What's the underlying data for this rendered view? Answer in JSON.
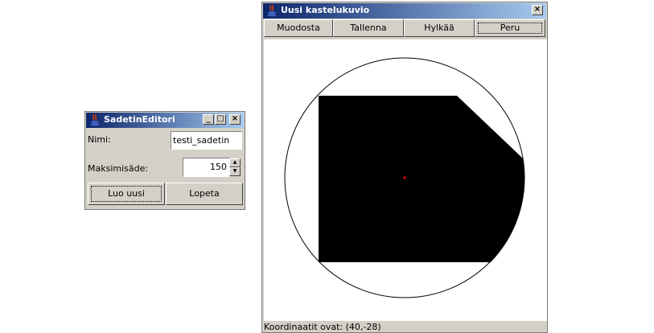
{
  "editor": {
    "title": "SadetinEditori",
    "title_buttons": {
      "minimize": "_",
      "maximize": "□",
      "close": "×"
    },
    "name_label": "Nimi:",
    "name_value": "testi_sadetin",
    "max_label": "Maksimisäde:",
    "max_value": "150",
    "create_button": "Luo uusi",
    "exit_button": "Lopeta"
  },
  "pattern_window": {
    "title": "Uusi kastelukuvio",
    "close": "×",
    "toolbar": [
      "Muodosta",
      "Tallenna",
      "Hylkää",
      "Peru"
    ],
    "status_text": "Koordinaatit ovat: (40,-28)",
    "shape_color": "#000000",
    "center_color": "#ff0000"
  }
}
